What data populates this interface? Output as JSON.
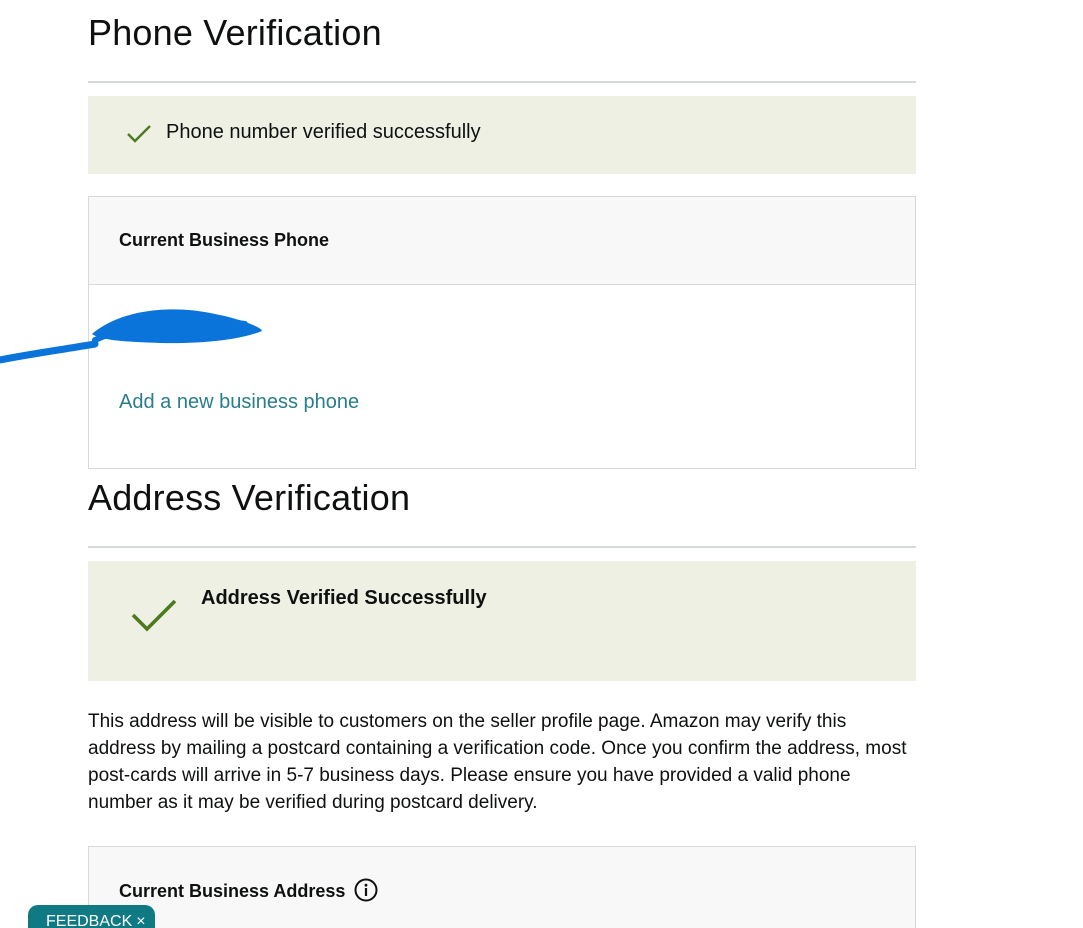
{
  "phone_section": {
    "title": "Phone Verification",
    "success_message": "Phone number verified successfully",
    "card_header": "Current Business Phone",
    "add_phone_link": "Add a new business phone"
  },
  "address_section": {
    "title": "Address Verification",
    "success_message": "Address Verified Successfully",
    "description": "This address will be visible to customers on the seller profile page. Amazon may verify this address by mailing a postcard containing a verification code. Once you confirm the address, most post-cards will arrive in 5-7 business days. Please ensure you have provided a valid phone number as it may be verified during postcard delivery.",
    "card_header": "Current Business Address"
  },
  "feedback": {
    "label": "FEEDBACK",
    "close_glyph": "×"
  },
  "colors": {
    "success_bg": "#edf0e3",
    "check_green": "#4d7a1e",
    "link": "#2a7d8c",
    "feedback_bg": "#0f7a84",
    "redaction_blue": "#0a74da"
  },
  "icons": {
    "success_check": "checkmark-icon",
    "info": "info-circle-icon",
    "close": "close-icon"
  }
}
